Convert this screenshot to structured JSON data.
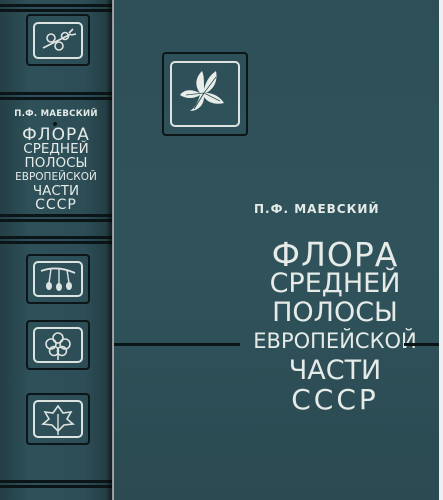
{
  "spine": {
    "author": "П.Ф. МАЕВСКИЙ",
    "title_lines": [
      "ФЛОРА",
      "СРЕДНЕЙ",
      "ПОЛОСЫ",
      "ЕВРОПЕЙСКОЙ",
      "ЧАСТИ",
      "СССР"
    ],
    "emblems": [
      "berry-branch-icon",
      "fruit-twig-icon",
      "flower-icon",
      "leaf-icon"
    ]
  },
  "front": {
    "author": "П.Ф. МАЕВСКИЙ",
    "title_lines": [
      "ФЛОРА",
      "СРЕДНЕЙ",
      "ПОЛОСЫ",
      "ЕВРОПЕЙСКОЙ",
      "ЧАСТИ",
      "СССР"
    ],
    "emblem": "maple-leaf-icon"
  },
  "colors": {
    "cloth": "#2e5058",
    "print": "#e6ebe8",
    "lines": "#0b1416"
  }
}
